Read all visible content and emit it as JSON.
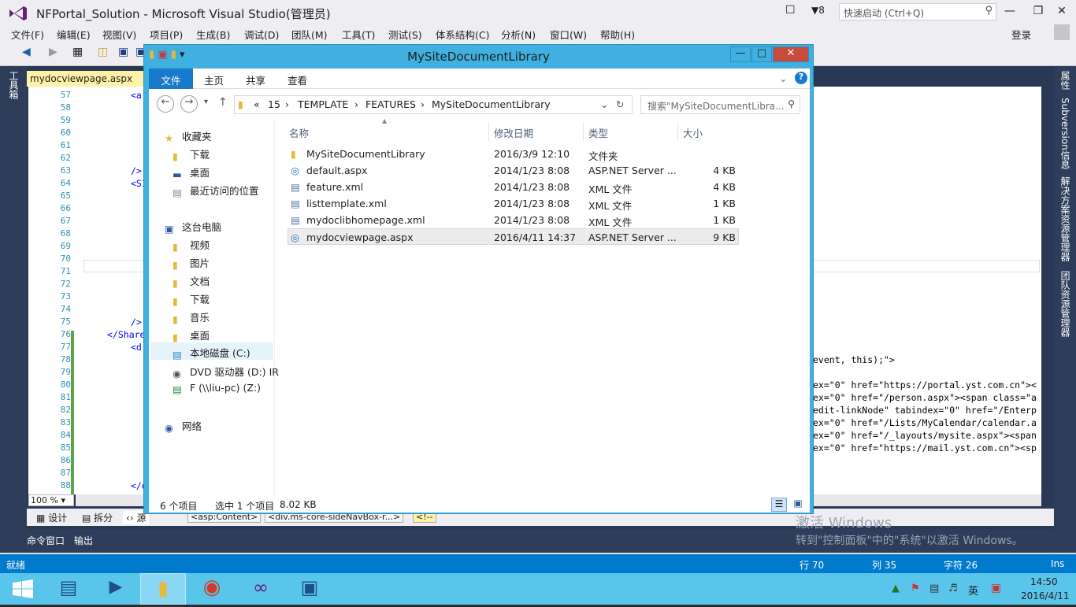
{
  "vs": {
    "title": "NFPortal_Solution - Microsoft Visual Studio(管理员)",
    "notif_count": "8",
    "quick_launch_placeholder": "快速启动 (Ctrl+Q)",
    "login": "登录",
    "menu": [
      "文件(F)",
      "编辑(E)",
      "视图(V)",
      "项目(P)",
      "生成(B)",
      "调试(D)",
      "团队(M)",
      "工具(T)",
      "测试(S)",
      "体系结构(C)",
      "分析(N)",
      "窗口(W)",
      "帮助(H)"
    ],
    "left_panel_label": "工具箱",
    "right_panels": [
      "属性",
      "Subversion信息",
      "解决方案资源管理器",
      "团队资源管理器"
    ],
    "doc_tab": "mydocviewpage.aspx",
    "line_numbers": [
      "57",
      "58",
      "59",
      "60",
      "61",
      "62",
      "63",
      "64",
      "65",
      "66",
      "67",
      "68",
      "69",
      "70",
      "71",
      "72",
      "73",
      "74",
      "75",
      "76",
      "77",
      "78",
      "79",
      "80",
      "81",
      "82",
      "83",
      "84",
      "85",
      "86",
      "87",
      "88"
    ],
    "code_left": {
      "57": "<a:",
      "63": "/>",
      "64": "<SI",
      "75": "/>",
      "76": "</Share",
      "77": "<d:",
      "88": "</d"
    },
    "code_right": {
      "78": "event, this);\">",
      "80": "ex=\"0\" href=\"https://portal.yst.com.cn\"><",
      "81": "ex=\"0\" href=\"/person.aspx\"><span class=\"a",
      "82": "edit-linkNode\" tabindex=\"0\" href=\"/Enterp",
      "83": "ex=\"0\" href=\"/Lists/MyCalendar/calendar.a",
      "84": "ex=\"0\" href=\"/_layouts/mysite.aspx\"><span",
      "85": "ex=\"0\" href=\"https://mail.yst.com.cn\"><sp"
    },
    "zoom": "100 %",
    "view_tabs": [
      "设计",
      "拆分",
      "源"
    ],
    "breadcrumb_tags": [
      "<asp:Content>",
      "<div.ms-core-sideNavBox-r...>",
      "<!--"
    ],
    "output_tabs": [
      "命令窗口",
      "输出"
    ],
    "watermark_title": "激活 Windows",
    "watermark_text": "转到\"控制面板\"中的\"系统\"以激活 Windows。",
    "status": {
      "ready": "就绪",
      "line": "行 70",
      "col": "列 35",
      "char": "字符 26",
      "mode": "Ins"
    }
  },
  "explorer": {
    "title": "MySiteDocumentLibrary",
    "ribbon_tabs": [
      "文件",
      "主页",
      "共享",
      "查看"
    ],
    "address": [
      "«",
      "15",
      "TEMPLATE",
      "FEATURES",
      "MySiteDocumentLibrary"
    ],
    "search_placeholder": "搜索\"MySiteDocumentLibra...",
    "tree": {
      "favorites": "收藏夹",
      "fav_items": [
        "下载",
        "桌面",
        "最近访问的位置"
      ],
      "this_pc": "这台电脑",
      "pc_items": [
        "视频",
        "图片",
        "文档",
        "下载",
        "音乐",
        "桌面",
        "本地磁盘 (C:)",
        "DVD 驱动器 (D:) IR",
        "F (\\\\liu-pc) (Z:)"
      ],
      "network": "网络"
    },
    "columns": [
      "名称",
      "修改日期",
      "类型",
      "大小"
    ],
    "files": [
      {
        "name": "MySiteDocumentLibrary",
        "date": "2016/3/9 12:10",
        "type": "文件夹",
        "size": "",
        "icon": "folder-icon"
      },
      {
        "name": "default.aspx",
        "date": "2014/1/23 8:08",
        "type": "ASP.NET Server ...",
        "size": "4 KB",
        "icon": "globe-icon"
      },
      {
        "name": "feature.xml",
        "date": "2014/1/23 8:08",
        "type": "XML 文件",
        "size": "4 KB",
        "icon": "xml-file-icon"
      },
      {
        "name": "listtemplate.xml",
        "date": "2014/1/23 8:08",
        "type": "XML 文件",
        "size": "1 KB",
        "icon": "xml-file-icon"
      },
      {
        "name": "mydoclibhomepage.xml",
        "date": "2014/1/23 8:08",
        "type": "XML 文件",
        "size": "1 KB",
        "icon": "xml-file-icon"
      },
      {
        "name": "mydocviewpage.aspx",
        "date": "2016/4/11 14:37",
        "type": "ASP.NET Server ...",
        "size": "9 KB",
        "icon": "globe-icon"
      }
    ],
    "status_count": "6 个项目",
    "status_selected": "选中 1 个项目",
    "status_size": "8.02 KB"
  },
  "taskbar": {
    "time": "14:50",
    "date": "2016/4/11",
    "ime": "英"
  },
  "colors": {
    "accent": "#007acc",
    "taskbar": "#5ac5ea",
    "explorer_frame": "#3fb0e0"
  }
}
